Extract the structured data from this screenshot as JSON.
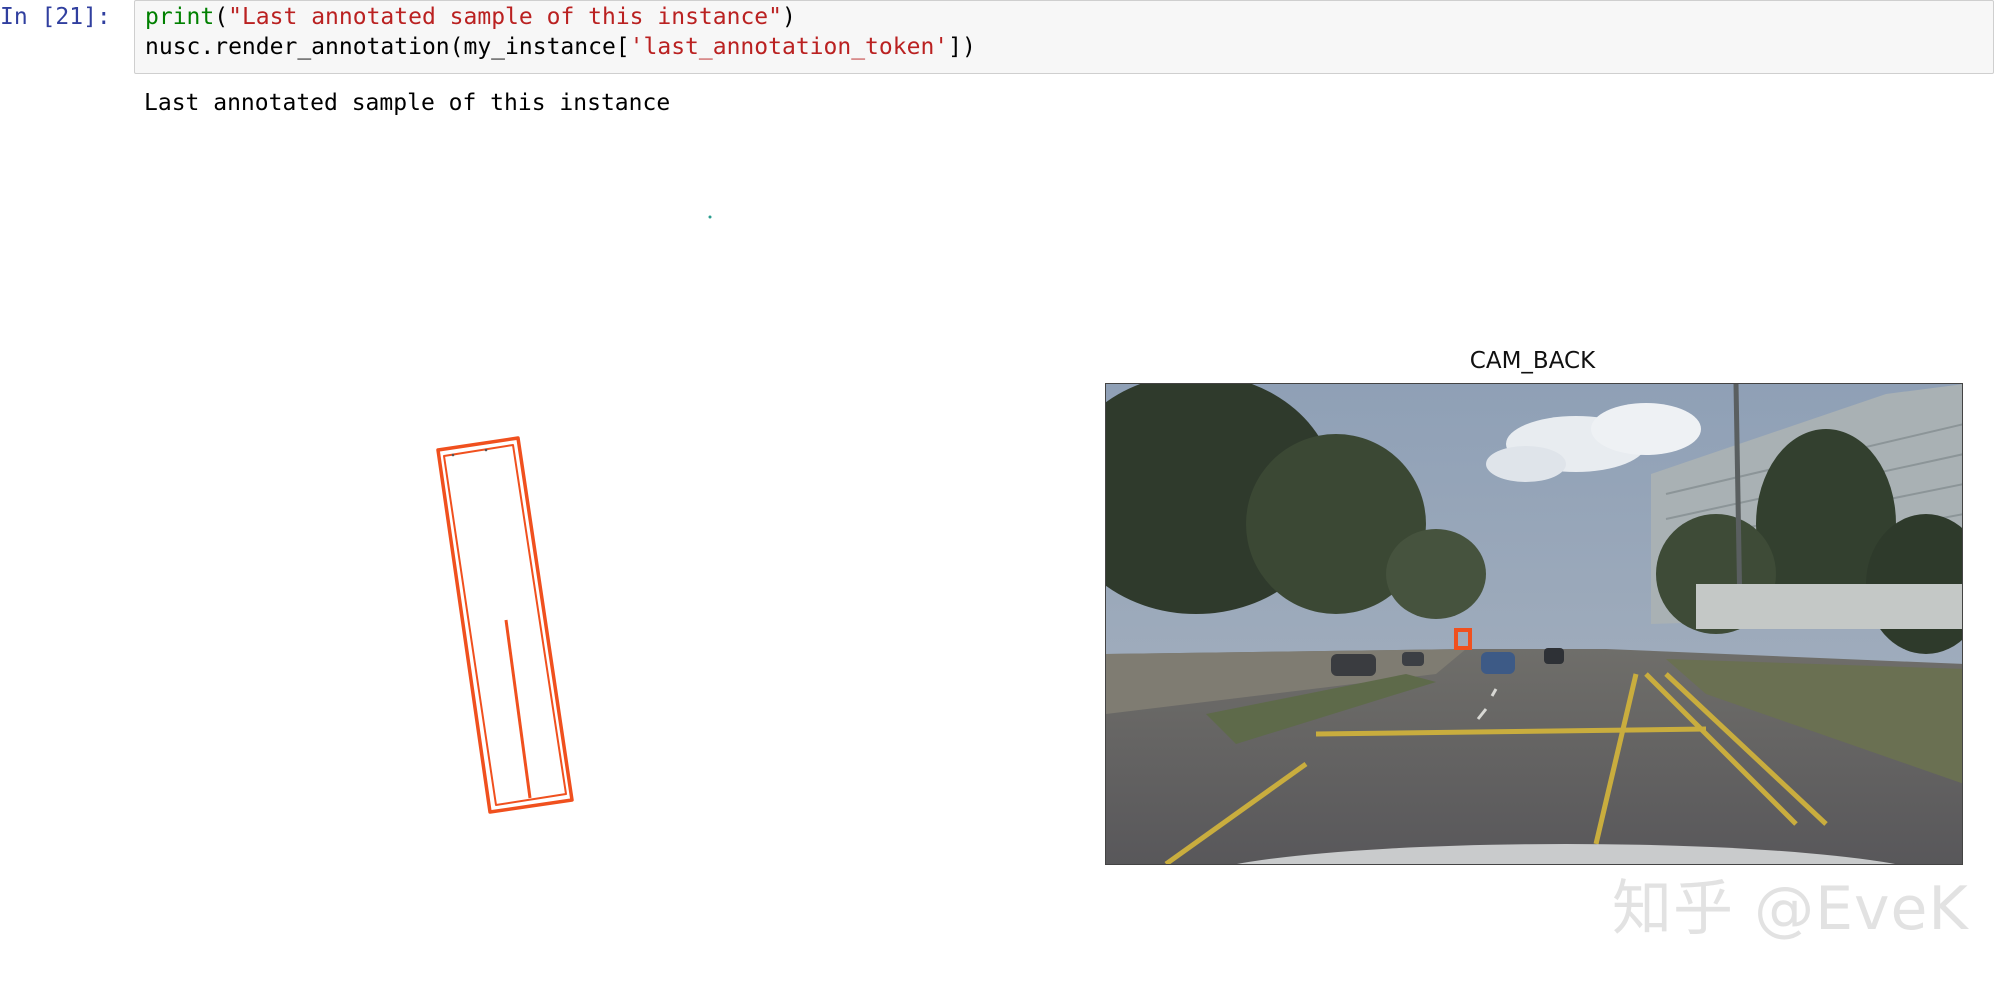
{
  "cell": {
    "prompt": "In [21]:",
    "code": {
      "line1": {
        "fn": "print",
        "open": "(",
        "str": "\"Last annotated sample of this instance\"",
        "close": ")"
      },
      "line2": {
        "prefix": "nusc.render_annotation(my_instance[",
        "str": "'last_annotation_token'",
        "suffix": "])"
      }
    },
    "output": "Last annotated sample of this instance"
  },
  "figure": {
    "camera_title": "CAM_BACK",
    "box_color": "#f0501e"
  },
  "watermark": "知乎 @EveK"
}
